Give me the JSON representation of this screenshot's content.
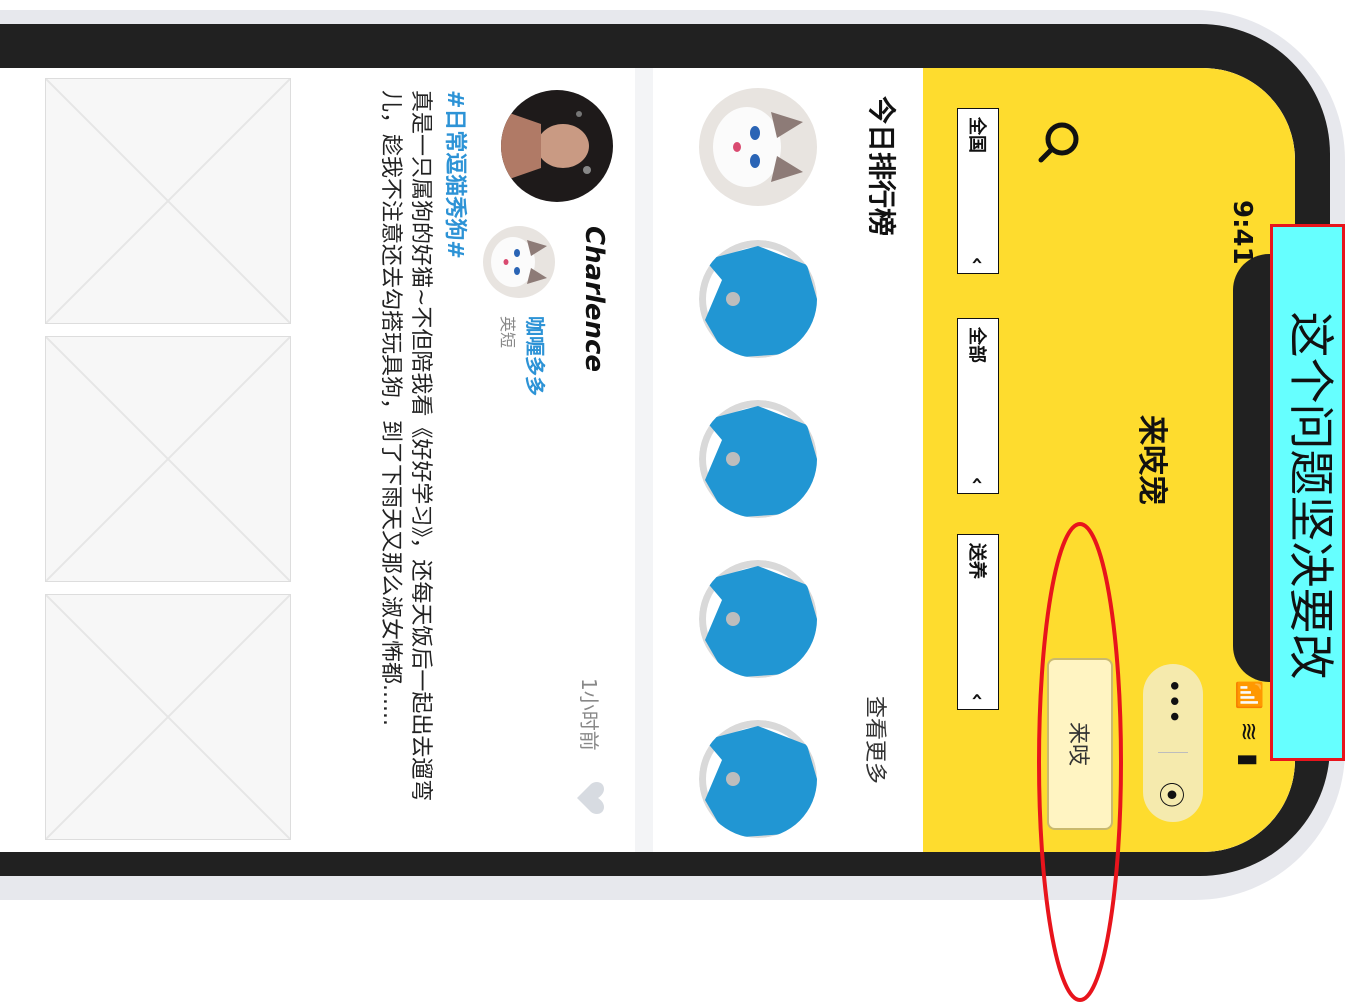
{
  "status_bar": {
    "time": "9:41",
    "signal": "📶",
    "wifi": "≋",
    "battery": "▮"
  },
  "header": {
    "title": "来吱宠",
    "capsule": {
      "more": "•••",
      "close": "⦿"
    },
    "post_button": "来吱",
    "search_icon": "search-icon",
    "filters": [
      {
        "label": "全国",
        "chevron": "‹"
      },
      {
        "label": "全部",
        "chevron": "‹"
      },
      {
        "label": "送养",
        "chevron": "‹"
      }
    ],
    "colors": {
      "header_bg": "#fedc2e",
      "accent_blue": "#2d93d6"
    }
  },
  "ranking": {
    "title": "今日排行榜",
    "more_label": "查看更多",
    "avatars": [
      "cat-photo",
      "placeholder-avatar",
      "placeholder-avatar",
      "placeholder-avatar",
      "placeholder-avatar"
    ]
  },
  "post": {
    "user_name": "Charlence",
    "pet_name": "咖喱多多",
    "pet_breed": "英短",
    "time": "1小时前",
    "tag": "#日常逗猫秀狗#",
    "body": "真是一只属狗的好猫~不但陪我看《好好学习》，还每天饭后一起出去遛弯儿，趁我不注意还去勾搭玩具狗，到了下雨天又那么淑女怖都......",
    "like_icon": "heart-icon"
  },
  "annotation": {
    "text": "这个问题坚决要改",
    "border_color": "#e8141c",
    "bg_color": "#66ffff"
  }
}
